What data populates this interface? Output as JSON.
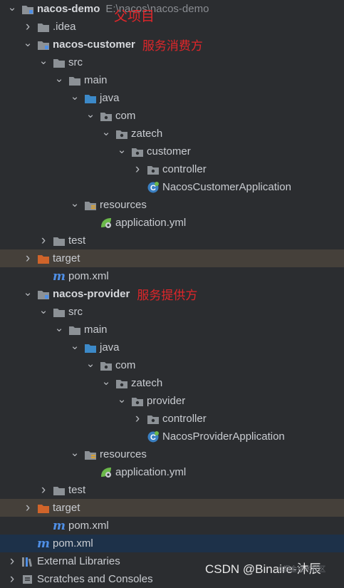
{
  "tree": [
    {
      "name": "nacos-demo",
      "bold": true,
      "expanded": true,
      "icon": "module-folder-icon",
      "path": "E:\\nacos\\nacos-demo",
      "note": "父项目"
    },
    {
      "name": ".idea",
      "expanded": false,
      "icon": "folder-icon"
    },
    {
      "name": "nacos-customer",
      "bold": true,
      "expanded": true,
      "icon": "module-folder-icon",
      "note": "服务消费方"
    },
    {
      "name": "src",
      "expanded": true,
      "icon": "folder-icon"
    },
    {
      "name": "main",
      "expanded": true,
      "icon": "folder-icon"
    },
    {
      "name": "java",
      "expanded": true,
      "icon": "source-folder-icon"
    },
    {
      "name": "com",
      "expanded": true,
      "icon": "package-icon"
    },
    {
      "name": "zatech",
      "expanded": true,
      "icon": "package-icon"
    },
    {
      "name": "customer",
      "expanded": true,
      "icon": "package-icon"
    },
    {
      "name": "controller",
      "expanded": false,
      "icon": "package-icon"
    },
    {
      "name": "NacosCustomerApplication",
      "icon": "spring-boot-class-icon"
    },
    {
      "name": "resources",
      "expanded": true,
      "icon": "resources-folder-icon"
    },
    {
      "name": "application.yml",
      "icon": "spring-config-icon"
    },
    {
      "name": "test",
      "expanded": false,
      "icon": "folder-icon"
    },
    {
      "name": "target",
      "expanded": false,
      "icon": "excluded-folder-icon"
    },
    {
      "name": "pom.xml",
      "icon": "maven-icon"
    },
    {
      "name": "nacos-provider",
      "bold": true,
      "expanded": true,
      "icon": "module-folder-icon",
      "note": "服务提供方"
    },
    {
      "name": "src",
      "expanded": true,
      "icon": "folder-icon"
    },
    {
      "name": "main",
      "expanded": true,
      "icon": "folder-icon"
    },
    {
      "name": "java",
      "expanded": true,
      "icon": "source-folder-icon"
    },
    {
      "name": "com",
      "expanded": true,
      "icon": "package-icon"
    },
    {
      "name": "zatech",
      "expanded": true,
      "icon": "package-icon"
    },
    {
      "name": "provider",
      "expanded": true,
      "icon": "package-icon"
    },
    {
      "name": "controller",
      "expanded": false,
      "icon": "package-icon"
    },
    {
      "name": "NacosProviderApplication",
      "icon": "spring-boot-class-icon"
    },
    {
      "name": "resources",
      "expanded": true,
      "icon": "resources-folder-icon"
    },
    {
      "name": "application.yml",
      "icon": "spring-config-icon"
    },
    {
      "name": "test",
      "expanded": false,
      "icon": "folder-icon"
    },
    {
      "name": "target",
      "expanded": false,
      "icon": "excluded-folder-icon"
    },
    {
      "name": "pom.xml",
      "icon": "maven-icon"
    },
    {
      "name": "pom.xml",
      "icon": "maven-icon"
    },
    {
      "name": "External Libraries",
      "expanded": false,
      "icon": "libraries-icon"
    },
    {
      "name": "Scratches and Consoles",
      "expanded": false,
      "icon": "scratches-icon"
    }
  ],
  "watermark": "CSDN @Binaire-沐辰",
  "colors": {
    "background": "#2b2d30",
    "selected_target": "#45403a",
    "selected_pom": "#1d3149",
    "annotation": "#e0262a"
  }
}
